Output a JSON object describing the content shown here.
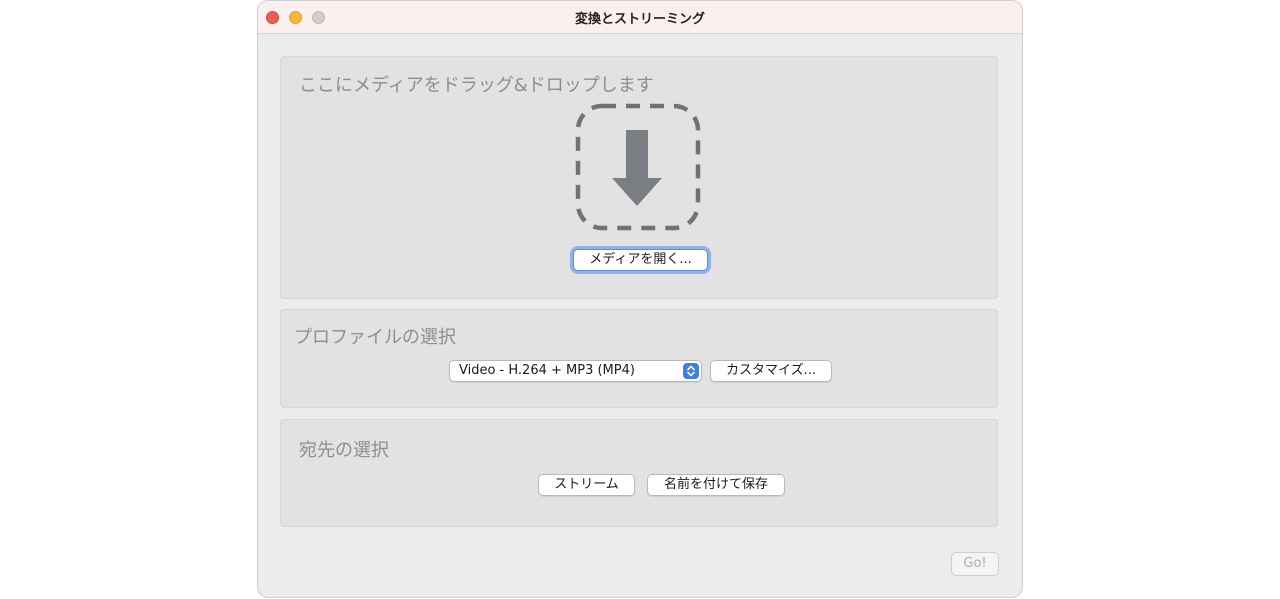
{
  "window": {
    "title": "変換とストリーミング"
  },
  "drop_section": {
    "title": "ここにメディアをドラッグ&ドロップします",
    "icon": "download-arrow-icon",
    "open_button_label": "メディアを開く..."
  },
  "profile_section": {
    "title": "プロファイルの選択",
    "selected_profile": "Video - H.264 + MP3 (MP4)",
    "customize_button_label": "カスタマイズ..."
  },
  "destination_section": {
    "title": "宛先の選択",
    "stream_button_label": "ストリーム",
    "save_as_button_label": "名前を付けて保存"
  },
  "footer": {
    "go_button_label": "Go!"
  },
  "colors": {
    "focus_ring": "#8db4ea",
    "select_accent": "#3f7fe3",
    "close": "#ee5c55",
    "minimize": "#f5b93a"
  }
}
